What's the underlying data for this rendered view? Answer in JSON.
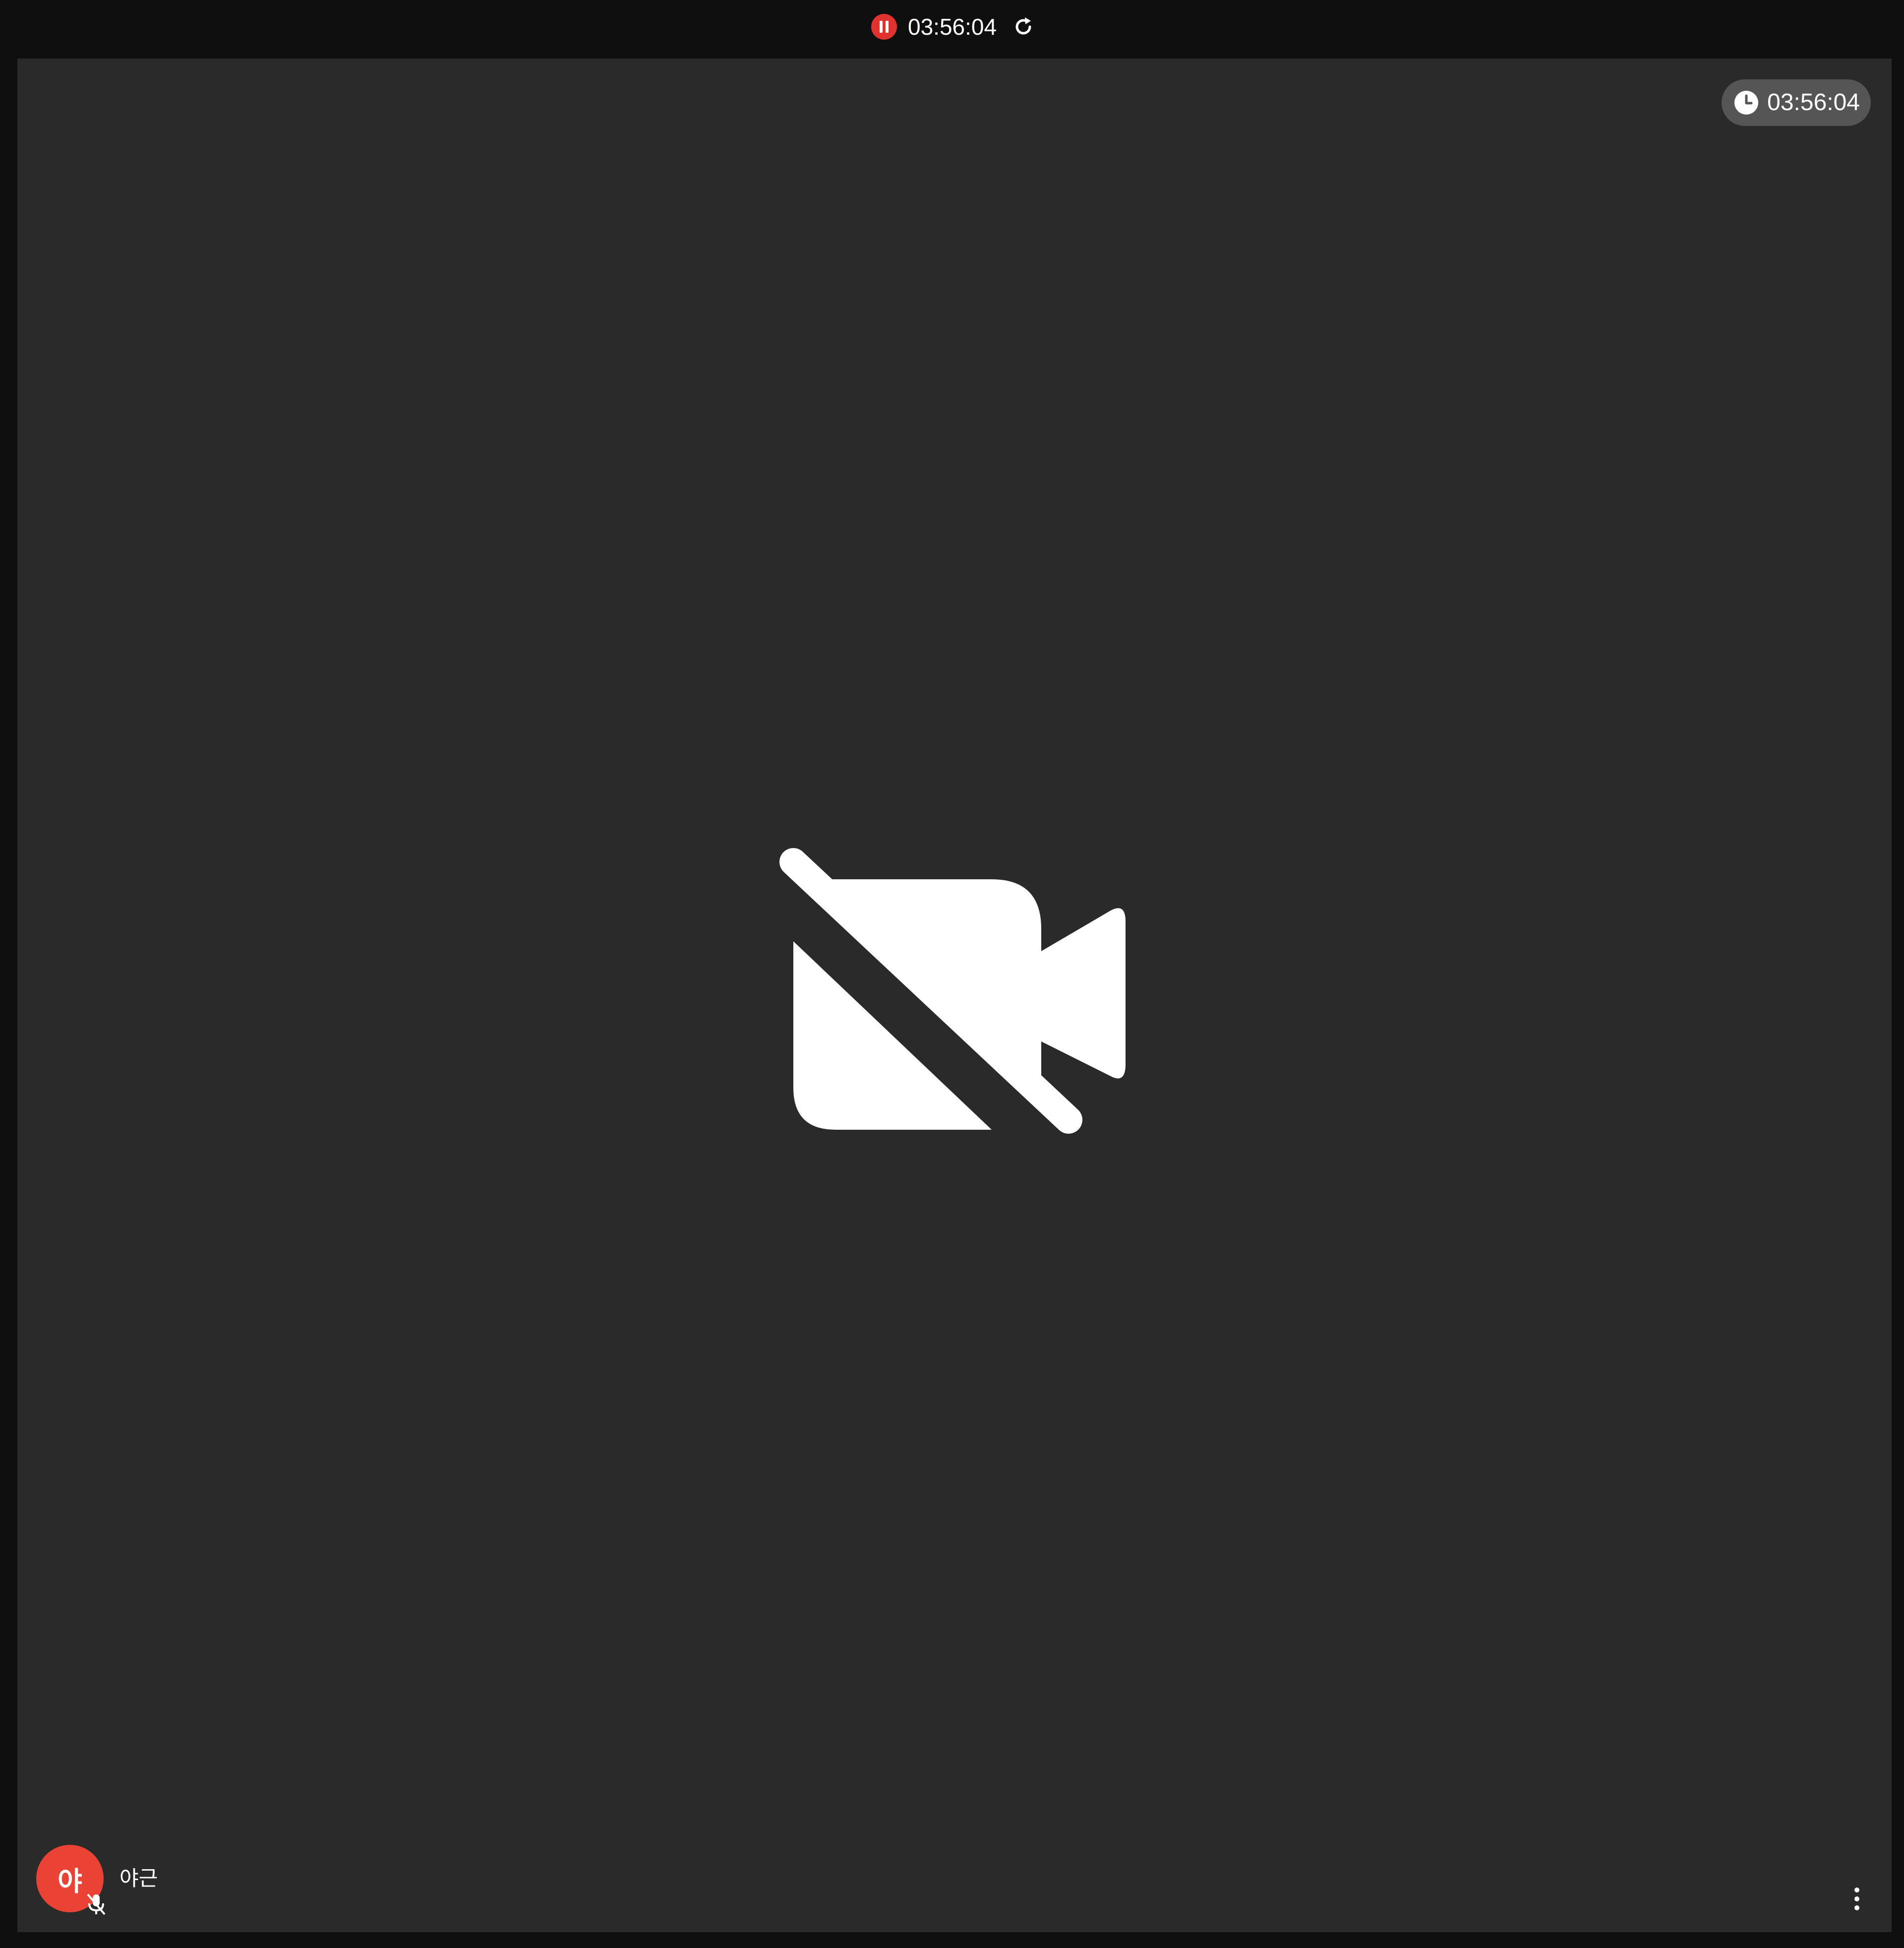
{
  "colors": {
    "background": "#0f0f0f",
    "tile": "#2a2a2a",
    "recording_red": "#e0332f",
    "avatar": "#ea4335",
    "timer_pill": "#555555",
    "icon": "#ffffff"
  },
  "recording_bar": {
    "elapsed": "03:56:04",
    "pause_icon": "pause-icon",
    "refresh_icon": "refresh-icon"
  },
  "tile": {
    "timer": "03:56:04",
    "timer_icon": "clock-icon",
    "center_icon": "video-camera-off-icon",
    "participant": {
      "initial": "야",
      "name": "야근",
      "mic_icon": "mic-off-icon"
    },
    "more_icon": "more-vertical-icon"
  }
}
